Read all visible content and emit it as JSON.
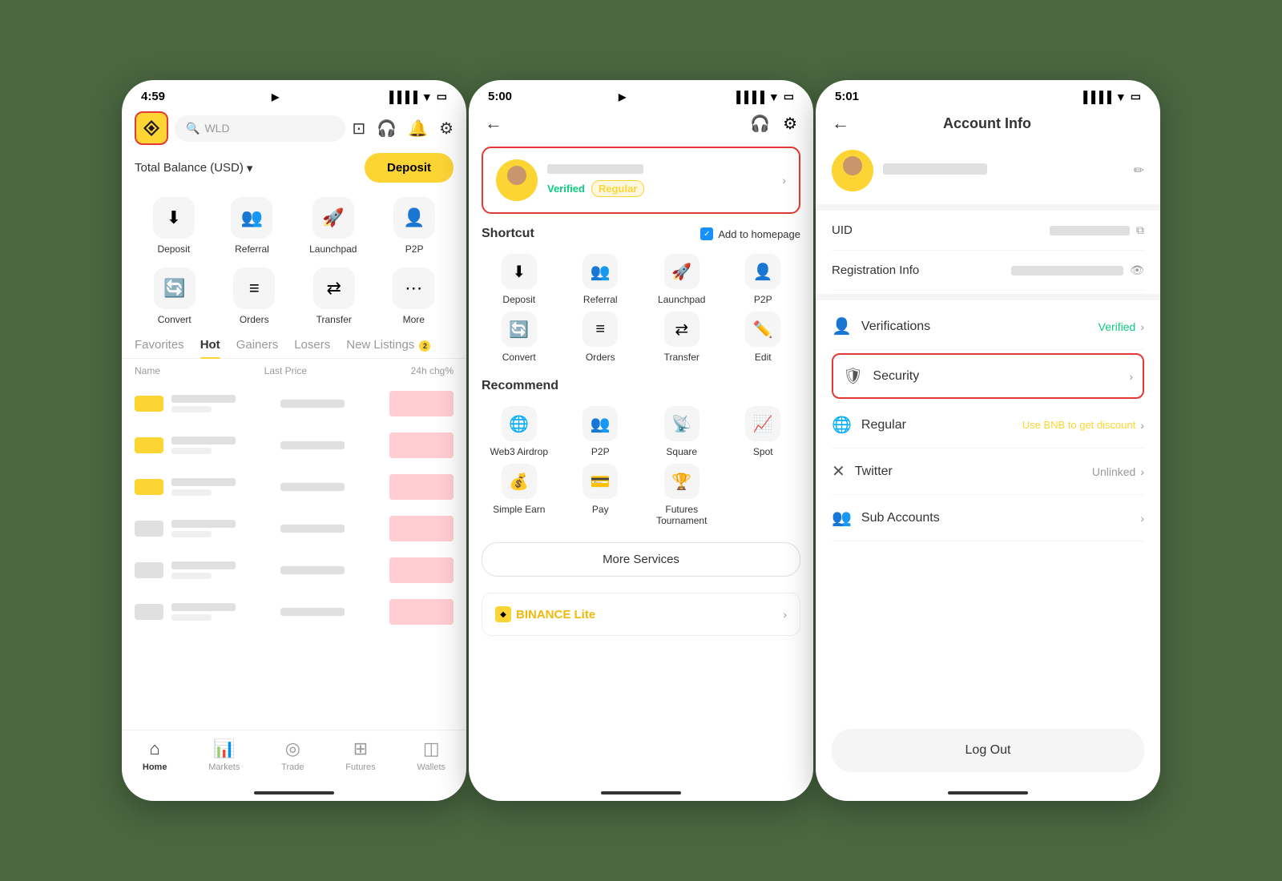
{
  "phone1": {
    "time": "4:59",
    "logo_alt": "Binance Logo",
    "search_placeholder": "WLD",
    "balance_label": "Total Balance (USD)",
    "deposit_btn": "Deposit",
    "quick_actions": [
      {
        "icon": "⬇",
        "label": "Deposit"
      },
      {
        "icon": "👤+",
        "label": "Referral"
      },
      {
        "icon": "🚀",
        "label": "Launchpad"
      },
      {
        "icon": "👥",
        "label": "P2P"
      }
    ],
    "quick_actions2": [
      {
        "icon": "🔄",
        "label": "Convert"
      },
      {
        "icon": "≡",
        "label": "Orders"
      },
      {
        "icon": "⇄",
        "label": "Transfer"
      },
      {
        "icon": "⋯",
        "label": "More"
      }
    ],
    "tabs": [
      "Favorites",
      "Hot",
      "Gainers",
      "Losers",
      "New Listings"
    ],
    "market_cols": [
      "Name",
      "Last Price",
      "24h chg%"
    ],
    "nav_items": [
      "Home",
      "Markets",
      "Trade",
      "Futures",
      "Wallets"
    ]
  },
  "phone2": {
    "time": "5:00",
    "badge_verified": "Verified",
    "badge_regular": "Regular",
    "shortcut_title": "Shortcut",
    "add_homepage": "Add to homepage",
    "shortcut_items": [
      {
        "icon": "⬇",
        "label": "Deposit"
      },
      {
        "icon": "👤",
        "label": "Referral"
      },
      {
        "icon": "🚀",
        "label": "Launchpad"
      },
      {
        "icon": "👥",
        "label": "P2P"
      },
      {
        "icon": "🔄",
        "label": "Convert"
      },
      {
        "icon": "≡",
        "label": "Orders"
      },
      {
        "icon": "⇄",
        "label": "Transfer"
      },
      {
        "icon": "✏️",
        "label": "Edit"
      }
    ],
    "recommend_title": "Recommend",
    "recommend_items": [
      {
        "icon": "🌐",
        "label": "Web3 Airdrop"
      },
      {
        "icon": "👥",
        "label": "P2P"
      },
      {
        "icon": "📡",
        "label": "Square"
      },
      {
        "icon": "📈",
        "label": "Spot"
      },
      {
        "icon": "💰",
        "label": "Simple Earn"
      },
      {
        "icon": "💳",
        "label": "Pay"
      },
      {
        "icon": "🏆",
        "label": "Futures Tournament"
      }
    ],
    "more_services_btn": "More Services",
    "binance_lite": "BINANCE",
    "binance_lite_suffix": "Lite"
  },
  "phone3": {
    "time": "5:01",
    "page_title": "Account Info",
    "uid_label": "UID",
    "reg_info_label": "Registration Info",
    "verifications_label": "Verifications",
    "verifications_value": "Verified",
    "security_label": "Security",
    "regular_label": "Regular",
    "regular_value": "Use BNB to get discount",
    "twitter_label": "Twitter",
    "twitter_value": "Unlinked",
    "sub_accounts_label": "Sub Accounts",
    "logout_btn": "Log Out"
  }
}
